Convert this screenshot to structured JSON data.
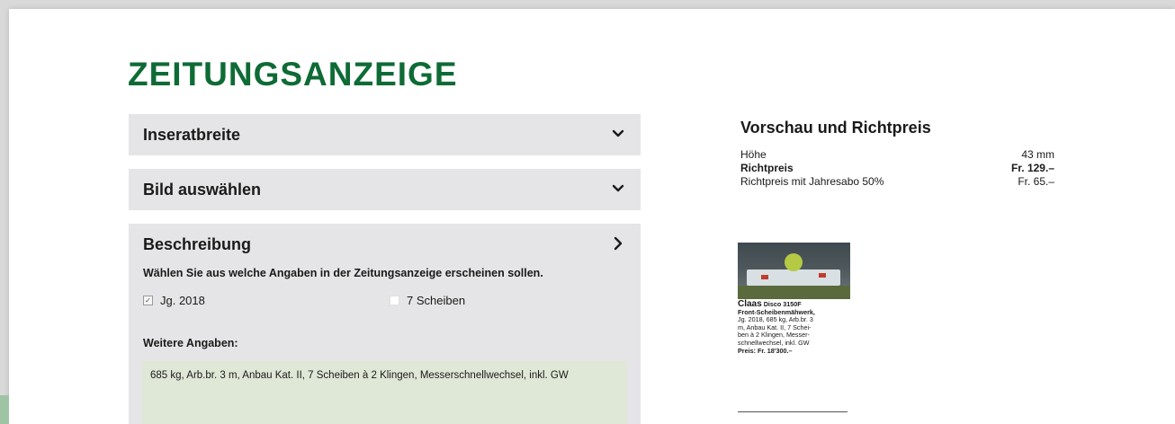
{
  "page": {
    "title": "ZEITUNGSANZEIGE"
  },
  "accordion": {
    "width_section": {
      "title": "Inseratbreite",
      "icon": "chevron-down-icon"
    },
    "image_section": {
      "title": "Bild auswählen",
      "icon": "chevron-down-icon"
    },
    "description_section": {
      "title": "Beschreibung",
      "icon": "chevron-right-icon",
      "hint": "Wählen Sie aus welche Angaben in der Zeitungsanzeige erscheinen sollen.",
      "options": [
        {
          "label": "Jg. 2018",
          "checked": true
        },
        {
          "label": "7 Scheiben",
          "checked": false
        }
      ],
      "more_label": "Weitere Angaben:",
      "more_value": "685 kg, Arb.br. 3 m, Anbau Kat. II, 7 Scheiben à 2 Klingen, Messerschnellwechsel, inkl. GW"
    }
  },
  "preview": {
    "title": "Vorschau und Richtpreis",
    "rows": [
      {
        "label": "Höhe",
        "value": "43 mm",
        "bold": false
      },
      {
        "label": "Richtpreis",
        "value": "Fr. 129.–",
        "bold": true
      },
      {
        "label": "Richtpreis mit Jahresabo 50%",
        "value": "Fr. 65.–",
        "bold": false
      }
    ],
    "ad": {
      "title": "Claas",
      "model": "Disco 3150F",
      "lines": [
        "Front-Scheibenmähwerk,",
        "Jg. 2018, 685 kg, Arb.br. 3",
        "m, Anbau Kat. II, 7 Schei-",
        "ben à 2 Klingen, Messer-",
        "schnellwechsel, inkl. GW"
      ],
      "price": "Preis: Fr. 18'300.–"
    }
  },
  "colors": {
    "brand_green": "#0e6b35",
    "panel_gray": "#e5e4e6",
    "textarea_green": "#dfe7d6"
  }
}
